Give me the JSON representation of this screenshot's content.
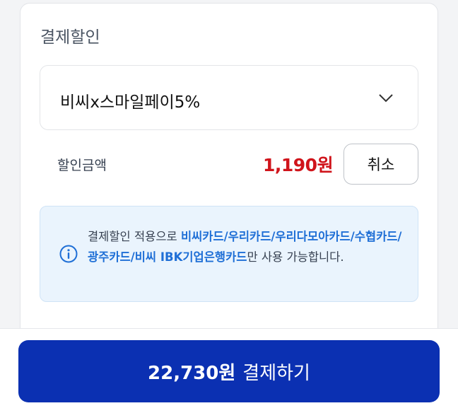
{
  "section": {
    "title": "결제할인"
  },
  "discount_select": {
    "selected": "비씨x스마일페이5%"
  },
  "discount": {
    "label": "할인금액",
    "amount": "1,190원",
    "cancel_label": "취소"
  },
  "notice": {
    "prefix": "결제할인 적용으로 ",
    "cards": "비씨카드/우리카드/우리다모아카드/수협카드/광주카드/비씨 IBK기업은행카드",
    "suffix": "만 사용 가능합니다."
  },
  "pay_button": {
    "amount": "22,730원",
    "label": "결제하기"
  },
  "colors": {
    "accent": "#0b30b2",
    "discount_red": "#d0141b",
    "link_blue": "#1f6fd6",
    "notice_bg": "#eaf4fd"
  }
}
